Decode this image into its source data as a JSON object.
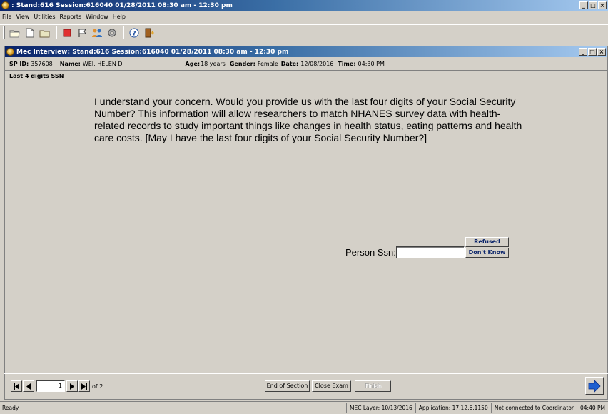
{
  "window": {
    "title": ": Stand:616 Session:616040 01/28/2011 08:30 am - 12:30 pm",
    "controls": [
      "_",
      "□",
      "×"
    ]
  },
  "menu": [
    "File",
    "View",
    "Utilities",
    "Reports",
    "Window",
    "Help"
  ],
  "toolbar": {
    "icons": [
      "open-folder-icon",
      "new-document-icon",
      "folder-icon",
      "stop-icon",
      "flag-icon",
      "people-icon",
      "settings-icon",
      "help-icon",
      "exit-door-icon"
    ]
  },
  "child_window": {
    "title": "Mec Interview: Stand:616 Session:616040 01/28/2011 08:30 am - 12:30 pm",
    "controls": [
      "_",
      "□",
      "×"
    ]
  },
  "participant": {
    "sp_id_label": "SP ID:",
    "sp_id": "357608",
    "name_label": "Name:",
    "name": "WEI, HELEN D",
    "age_label": "Age:",
    "age": "18 years",
    "gender_label": "Gender:",
    "gender": "Female",
    "date_label": "Date:",
    "date": "12/08/2016",
    "time_label": "Time:",
    "time": "04:30 PM"
  },
  "section": {
    "title": "Last 4 digits SSN"
  },
  "question": {
    "text": "I understand your concern. Would you provide us with the last four digits of your Social Security Number? This information will allow researchers to match NHANES survey data with health-related records to study important things like changes in health status, eating patterns and health care costs. [May I have the last four digits of your Social Security Number?]"
  },
  "field": {
    "label": "Person Ssn:",
    "value": "",
    "refused_label": "Refused",
    "dont_know_label": "Don't Know"
  },
  "navigation": {
    "page": "1",
    "of_text": "of 2",
    "end_of_section": "End of Section",
    "close_exam": "Close Exam",
    "finish": "Finish"
  },
  "status": {
    "ready": "Ready",
    "mec_layer": "MEC Layer: 10/13/2016",
    "application": "Application: 17.12.6.1150",
    "connection": "Not connected to Coordinator",
    "clock": "04:40 PM"
  },
  "colors": {
    "titlebar": "#0a246a",
    "face": "#d4d0c8",
    "next_arrow": "#1e5fd0"
  }
}
